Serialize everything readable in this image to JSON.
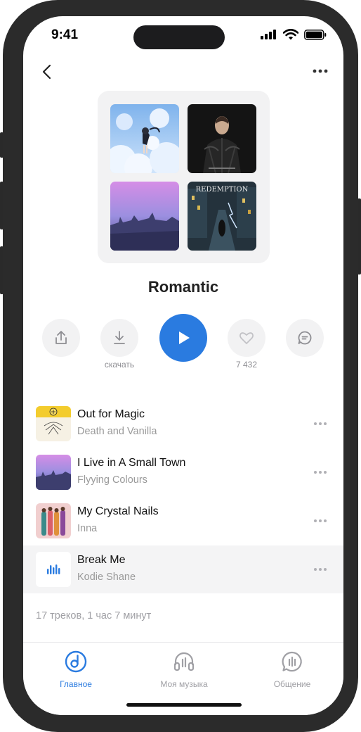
{
  "status_bar": {
    "time": "9:41"
  },
  "playlist": {
    "title": "Romantic",
    "covers": [
      "anime-girl-clouds-cover",
      "woman-black-leather-cover",
      "purple-city-sunset-cover",
      "redemption-dark-street-cover"
    ]
  },
  "actions": {
    "download_label": "скачать",
    "likes_count": "7 432"
  },
  "tracks": [
    {
      "title": "Out for Magic",
      "artist": "Death and Vanilla"
    },
    {
      "title": "I Live in A Small Town",
      "artist": "Flyying Colours"
    },
    {
      "title": "My Crystal Nails",
      "artist": "Inna"
    },
    {
      "title": "Break Me",
      "artist": "Kodie Shane"
    }
  ],
  "summary": "17 треков, 1 час 7 минут",
  "tabs": [
    {
      "label": "Главное",
      "icon": "music-note-circle-icon",
      "active": true
    },
    {
      "label": "Моя музыка",
      "icon": "headphones-icon",
      "active": false
    },
    {
      "label": "Общение",
      "icon": "chat-bubble-icon",
      "active": false
    }
  ],
  "colors": {
    "accent": "#2a7be0",
    "frame": "#2b2b2b"
  }
}
